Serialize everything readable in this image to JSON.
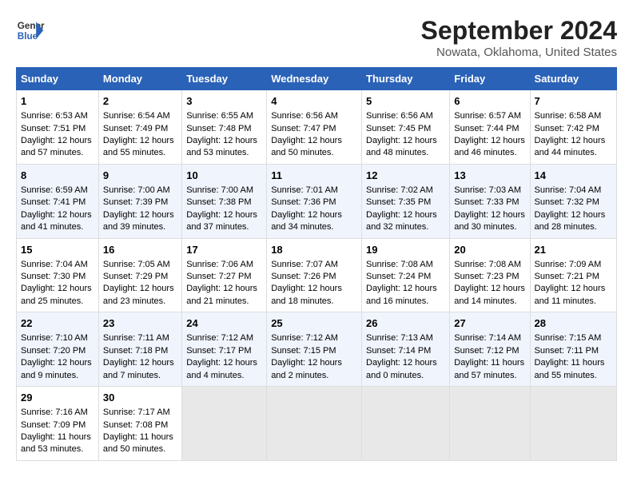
{
  "header": {
    "logo_line1": "General",
    "logo_line2": "Blue",
    "title": "September 2024",
    "subtitle": "Nowata, Oklahoma, United States"
  },
  "days_of_week": [
    "Sunday",
    "Monday",
    "Tuesday",
    "Wednesday",
    "Thursday",
    "Friday",
    "Saturday"
  ],
  "weeks": [
    [
      {
        "day": "1",
        "sunrise": "6:53 AM",
        "sunset": "7:51 PM",
        "daylight": "12 hours and 57 minutes."
      },
      {
        "day": "2",
        "sunrise": "6:54 AM",
        "sunset": "7:49 PM",
        "daylight": "12 hours and 55 minutes."
      },
      {
        "day": "3",
        "sunrise": "6:55 AM",
        "sunset": "7:48 PM",
        "daylight": "12 hours and 53 minutes."
      },
      {
        "day": "4",
        "sunrise": "6:56 AM",
        "sunset": "7:47 PM",
        "daylight": "12 hours and 50 minutes."
      },
      {
        "day": "5",
        "sunrise": "6:56 AM",
        "sunset": "7:45 PM",
        "daylight": "12 hours and 48 minutes."
      },
      {
        "day": "6",
        "sunrise": "6:57 AM",
        "sunset": "7:44 PM",
        "daylight": "12 hours and 46 minutes."
      },
      {
        "day": "7",
        "sunrise": "6:58 AM",
        "sunset": "7:42 PM",
        "daylight": "12 hours and 44 minutes."
      }
    ],
    [
      {
        "day": "8",
        "sunrise": "6:59 AM",
        "sunset": "7:41 PM",
        "daylight": "12 hours and 41 minutes."
      },
      {
        "day": "9",
        "sunrise": "7:00 AM",
        "sunset": "7:39 PM",
        "daylight": "12 hours and 39 minutes."
      },
      {
        "day": "10",
        "sunrise": "7:00 AM",
        "sunset": "7:38 PM",
        "daylight": "12 hours and 37 minutes."
      },
      {
        "day": "11",
        "sunrise": "7:01 AM",
        "sunset": "7:36 PM",
        "daylight": "12 hours and 34 minutes."
      },
      {
        "day": "12",
        "sunrise": "7:02 AM",
        "sunset": "7:35 PM",
        "daylight": "12 hours and 32 minutes."
      },
      {
        "day": "13",
        "sunrise": "7:03 AM",
        "sunset": "7:33 PM",
        "daylight": "12 hours and 30 minutes."
      },
      {
        "day": "14",
        "sunrise": "7:04 AM",
        "sunset": "7:32 PM",
        "daylight": "12 hours and 28 minutes."
      }
    ],
    [
      {
        "day": "15",
        "sunrise": "7:04 AM",
        "sunset": "7:30 PM",
        "daylight": "12 hours and 25 minutes."
      },
      {
        "day": "16",
        "sunrise": "7:05 AM",
        "sunset": "7:29 PM",
        "daylight": "12 hours and 23 minutes."
      },
      {
        "day": "17",
        "sunrise": "7:06 AM",
        "sunset": "7:27 PM",
        "daylight": "12 hours and 21 minutes."
      },
      {
        "day": "18",
        "sunrise": "7:07 AM",
        "sunset": "7:26 PM",
        "daylight": "12 hours and 18 minutes."
      },
      {
        "day": "19",
        "sunrise": "7:08 AM",
        "sunset": "7:24 PM",
        "daylight": "12 hours and 16 minutes."
      },
      {
        "day": "20",
        "sunrise": "7:08 AM",
        "sunset": "7:23 PM",
        "daylight": "12 hours and 14 minutes."
      },
      {
        "day": "21",
        "sunrise": "7:09 AM",
        "sunset": "7:21 PM",
        "daylight": "12 hours and 11 minutes."
      }
    ],
    [
      {
        "day": "22",
        "sunrise": "7:10 AM",
        "sunset": "7:20 PM",
        "daylight": "12 hours and 9 minutes."
      },
      {
        "day": "23",
        "sunrise": "7:11 AM",
        "sunset": "7:18 PM",
        "daylight": "12 hours and 7 minutes."
      },
      {
        "day": "24",
        "sunrise": "7:12 AM",
        "sunset": "7:17 PM",
        "daylight": "12 hours and 4 minutes."
      },
      {
        "day": "25",
        "sunrise": "7:12 AM",
        "sunset": "7:15 PM",
        "daylight": "12 hours and 2 minutes."
      },
      {
        "day": "26",
        "sunrise": "7:13 AM",
        "sunset": "7:14 PM",
        "daylight": "12 hours and 0 minutes."
      },
      {
        "day": "27",
        "sunrise": "7:14 AM",
        "sunset": "7:12 PM",
        "daylight": "11 hours and 57 minutes."
      },
      {
        "day": "28",
        "sunrise": "7:15 AM",
        "sunset": "7:11 PM",
        "daylight": "11 hours and 55 minutes."
      }
    ],
    [
      {
        "day": "29",
        "sunrise": "7:16 AM",
        "sunset": "7:09 PM",
        "daylight": "11 hours and 53 minutes."
      },
      {
        "day": "30",
        "sunrise": "7:17 AM",
        "sunset": "7:08 PM",
        "daylight": "11 hours and 50 minutes."
      },
      null,
      null,
      null,
      null,
      null
    ]
  ]
}
